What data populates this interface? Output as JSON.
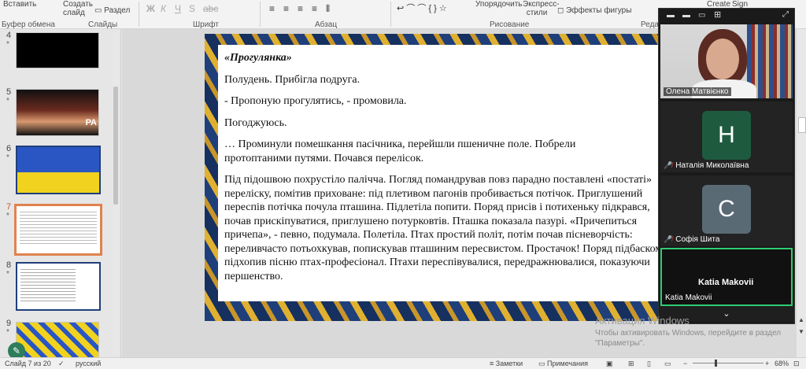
{
  "ribbon": {
    "insert_label": "Вставить",
    "clipboard_group": "Буфер обмена",
    "new_slide_label": "Создать слайд",
    "section_label": "Раздел",
    "slides_group": "Слайды",
    "font_group": "Шрифт",
    "paragraph_group": "Абзац",
    "drawing_group": "Рисование",
    "arrange_label": "Упорядочить",
    "express_styles_label": "Экспресс-стили",
    "shape_effects_label": "Эффекты фигуры",
    "create_label": "Create",
    "sign_label": "Sign",
    "edit_group_partial": "Реда"
  },
  "thumbnails": [
    {
      "num": "4",
      "star": "*"
    },
    {
      "num": "5",
      "star": "*",
      "overlay": "РА"
    },
    {
      "num": "6",
      "star": "*"
    },
    {
      "num": "7",
      "star": "*",
      "selected": true
    },
    {
      "num": "8",
      "star": "*"
    },
    {
      "num": "9",
      "star": "*"
    }
  ],
  "slide": {
    "title": "«Прогулянка»",
    "paragraphs": [
      "Полудень. Прибігла подруга.",
      "- Пропоную прогулятись, - промовила.",
      "Погоджуюсь.",
      "… Проминули помешкання пасічника, перейшли пшеничне поле. Побрели протоптаними путями. Почався перелісок.",
      "Під підошвою похрустіло палічча. Погляд помандрував повз парадно поставлені «постаті» переліску, помітив приховане: під плетивом пагонів пробивається потічок. Приглушений переспів потічка почула пташина. Підлетіла попити. Поряд присів і потихеньку підкрався, почав прискіпуватися, приглушено потурковтів. Пташка показала пазурі. «Причепиться причепа», - певно, подумала. Полетіла. Птах простий політ, потім почав пісневорчість: переливчасто потьохкував, попискував пташиним пересвистом. Простачок! Поряд підбаском підхопив пісню птах-професіонал. Птахи переспівувалися, передражнювалися, показуючи першенство."
    ]
  },
  "zoom": {
    "participants": [
      {
        "name": "Олена Матвієнко",
        "type": "video"
      },
      {
        "name": "Наталія Миколаївна",
        "letter": "H",
        "muted": true,
        "color": "#1e5b3e"
      },
      {
        "name": "Софія Шита",
        "letter": "C",
        "muted": true,
        "color": "#5a6a75"
      },
      {
        "name": "Katia Makovii",
        "active": true
      }
    ]
  },
  "status": {
    "slide_info": "Слайд 7 из 20",
    "language": "русский",
    "notes_label": "Заметки",
    "comments_label": "Примечания",
    "zoom_level": "68%"
  },
  "watermark": {
    "title": "Активация Windows",
    "line": "Чтобы активировать Windows, перейдите в раздел \"Параметры\"."
  },
  "colors": {
    "accent": "#c55a35",
    "zoom_active": "#2ecc71"
  }
}
